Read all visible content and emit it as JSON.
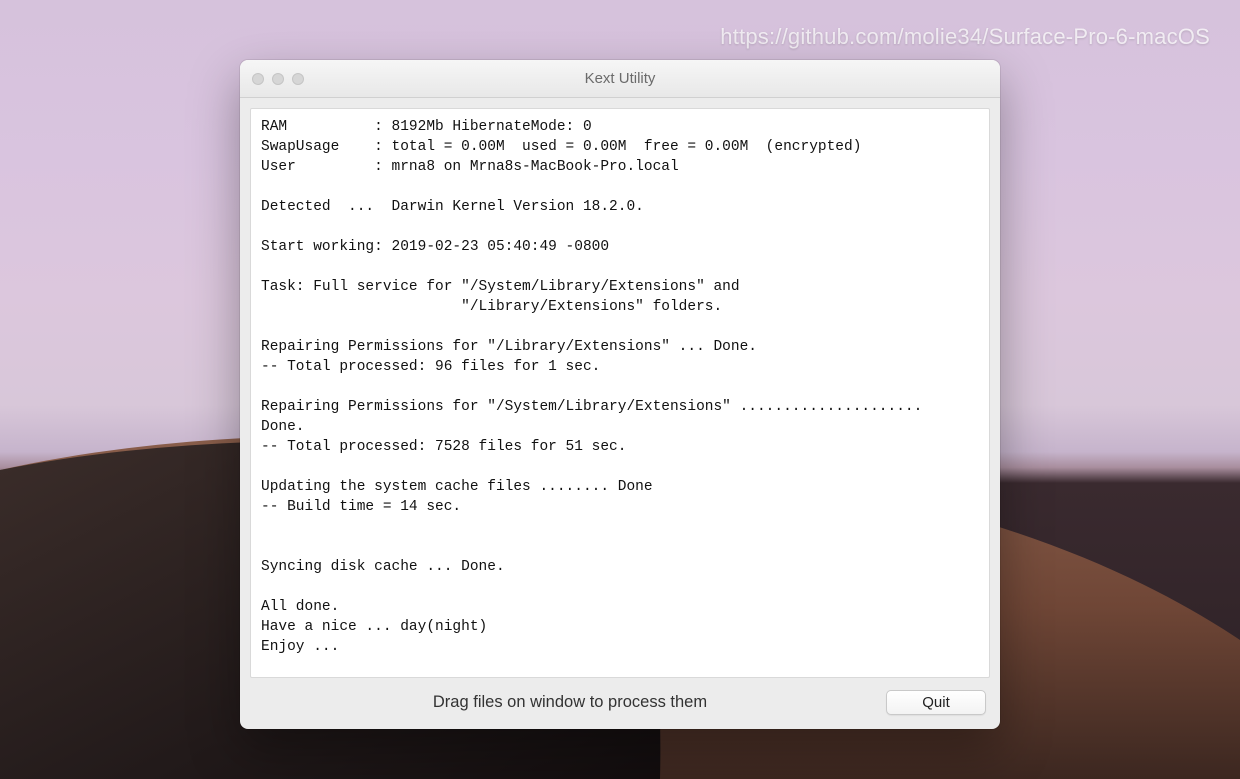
{
  "watermark": "https://github.com/molie34/Surface-Pro-6-macOS",
  "window": {
    "title": "Kext Utility",
    "footer_hint": "Drag files on window to process them",
    "quit_label": "Quit"
  },
  "console": {
    "text": "RAM          : 8192Mb HibernateMode: 0\nSwapUsage    : total = 0.00M  used = 0.00M  free = 0.00M  (encrypted)\nUser         : mrna8 on Mrna8s-MacBook-Pro.local\n\nDetected  ...  Darwin Kernel Version 18.2.0.\n\nStart working: 2019-02-23 05:40:49 -0800\n\nTask: Full service for \"/System/Library/Extensions\" and\n                       \"/Library/Extensions\" folders.\n\nRepairing Permissions for \"/Library/Extensions\" ... Done.\n-- Total processed: 96 files for 1 sec.\n\nRepairing Permissions for \"/System/Library/Extensions\" .....................\nDone.\n-- Total processed: 7528 files for 51 sec.\n\nUpdating the system cache files ........ Done\n-- Build time = 14 sec.\n\n\nSyncing disk cache ... Done.\n\nAll done.\nHave a nice ... day(night)\nEnjoy ..."
  }
}
